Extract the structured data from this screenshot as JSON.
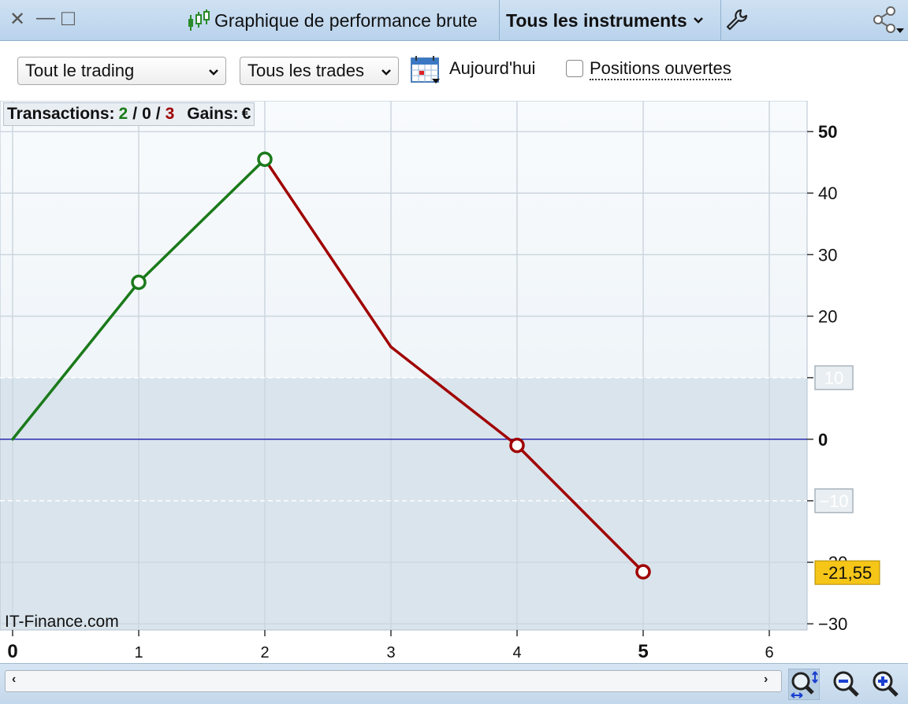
{
  "window": {
    "title": "Graphique de performance brute",
    "instrument_label": "Tous les instruments",
    "close_glyph": "✕",
    "minimize_glyph": "—",
    "maximize_glyph": "□"
  },
  "toolbar": {
    "trading_select": "Tout le trading",
    "trades_select": "Tous les trades",
    "date_label": "Aujourd'hui",
    "open_positions_label": "Positions ouvertes",
    "open_positions_checked": false
  },
  "stats": {
    "transactions_label": "Transactions:",
    "wins": "2",
    "neutral": "0",
    "losses": "3",
    "separator": "/",
    "gains_label": "Gains:",
    "currency": "€"
  },
  "watermark": "IT-Finance.com",
  "current_value_label": "-21,55",
  "chart_data": {
    "type": "line",
    "x": [
      0,
      1,
      2,
      3,
      4,
      5
    ],
    "y": [
      0,
      25.5,
      45.5,
      15,
      -1,
      -21.55
    ],
    "markers_at": [
      1,
      2,
      4,
      5
    ],
    "xlim": [
      -0.1,
      6.3
    ],
    "ylim": [
      -31,
      55
    ],
    "x_ticks": [
      "0",
      "1",
      "2",
      "3",
      "4",
      "5",
      "6"
    ],
    "y_ticks": [
      "50",
      "40",
      "30",
      "20",
      "10",
      "0",
      "−10",
      "−20",
      "−30"
    ],
    "grid": true,
    "colors": {
      "gain": "#1a7a1a",
      "loss": "#a00000",
      "zero_line": "#2b2bb0",
      "current_badge": "#f5c518"
    },
    "bold_x_ticks": [
      "0",
      "5"
    ],
    "bold_y_ticks": [
      "50",
      "0"
    ],
    "band_ticks": [
      "10",
      "−10"
    ]
  },
  "icons": {
    "chart_icon": "candlestick-icon",
    "settings_icon": "wrench-icon",
    "share_icon": "share-icon",
    "calendar_icon": "calendar-icon",
    "zoom_fit_icon": "zoom-fit-icon",
    "zoom_out_icon": "zoom-out-icon",
    "zoom_in_icon": "zoom-in-icon"
  },
  "scroll": {
    "left": "‹",
    "right": "›"
  }
}
